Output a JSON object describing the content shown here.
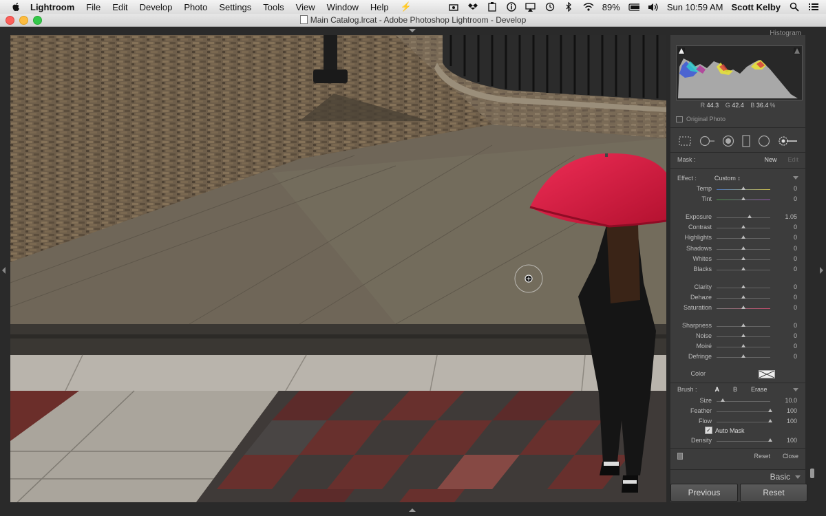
{
  "menubar": {
    "menus": [
      "Lightroom",
      "File",
      "Edit",
      "Develop",
      "Photo",
      "Settings",
      "Tools",
      "View",
      "Window",
      "Help"
    ],
    "battery": "89%",
    "clock": "Sun 10:59 AM",
    "user": "Scott Kelby"
  },
  "window": {
    "title": "Main Catalog.lrcat - Adobe Photoshop Lightroom - Develop"
  },
  "histogram": {
    "header": "Histogram",
    "r_label": "R",
    "r_value": "44.3",
    "g_label": "G",
    "g_value": "42.4",
    "b_label": "B",
    "b_value": "36.4",
    "unit": "%",
    "original_photo": "Original Photo"
  },
  "mask": {
    "label": "Mask :",
    "new": "New",
    "edit": "Edit"
  },
  "effect": {
    "label": "Effect :",
    "value": "Custom ↕"
  },
  "sliders": [
    {
      "label": "Temp",
      "value": "0"
    },
    {
      "label": "Tint",
      "value": "0"
    },
    {
      "label": "Exposure",
      "value": "1.05"
    },
    {
      "label": "Contrast",
      "value": "0"
    },
    {
      "label": "Highlights",
      "value": "0"
    },
    {
      "label": "Shadows",
      "value": "0"
    },
    {
      "label": "Whites",
      "value": "0"
    },
    {
      "label": "Blacks",
      "value": "0"
    },
    {
      "label": "Clarity",
      "value": "0"
    },
    {
      "label": "Dehaze",
      "value": "0"
    },
    {
      "label": "Saturation",
      "value": "0"
    },
    {
      "label": "Sharpness",
      "value": "0"
    },
    {
      "label": "Noise",
      "value": "0"
    },
    {
      "label": "Moiré",
      "value": "0"
    },
    {
      "label": "Defringe",
      "value": "0"
    }
  ],
  "color_label": "Color",
  "brush": {
    "label": "Brush :",
    "a": "A",
    "b": "B",
    "erase": "Erase",
    "size_label": "Size",
    "size_value": "10.0",
    "feather_label": "Feather",
    "feather_value": "100",
    "flow_label": "Flow",
    "flow_value": "100",
    "auto_mask": "Auto Mask",
    "density_label": "Density",
    "density_value": "100"
  },
  "footer": {
    "reset": "Reset",
    "close": "Close"
  },
  "basic_panel": "Basic",
  "buttons": {
    "previous": "Previous",
    "reset": "Reset"
  },
  "colors": {
    "umbrella": "#d6173b",
    "panel_bg": "#3c3c3c",
    "app_bg": "#2a2a2a"
  }
}
